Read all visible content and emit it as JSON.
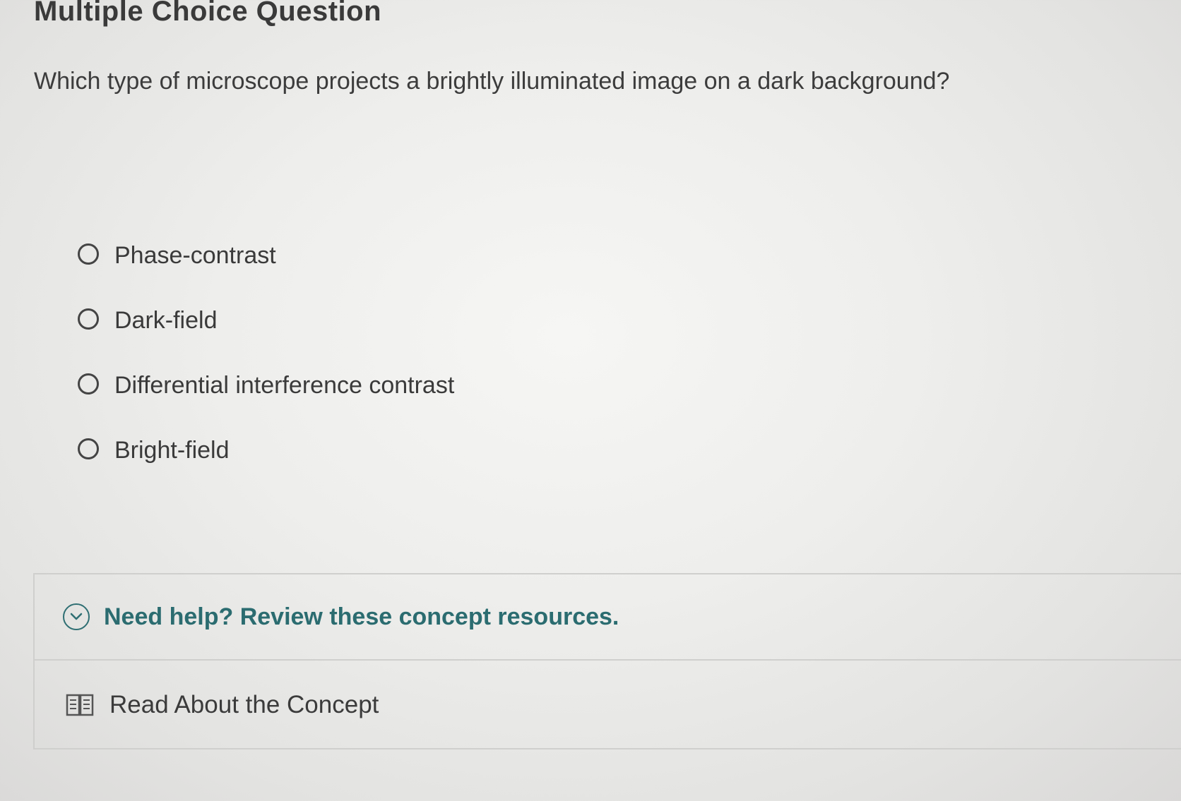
{
  "question_type": "Multiple Choice Question",
  "question_text": "Which type of microscope projects a brightly illuminated image on a dark background?",
  "options": [
    {
      "label": "Phase-contrast"
    },
    {
      "label": "Dark-field"
    },
    {
      "label": "Differential interference contrast"
    },
    {
      "label": "Bright-field"
    }
  ],
  "help": {
    "toggle_label": "Need help? Review these concept resources.",
    "toggle_icon": "chevron-down-circle-icon",
    "resource_label": "Read About the Concept",
    "resource_icon": "book-icon"
  },
  "colors": {
    "help_accent": "#2b6c70"
  }
}
